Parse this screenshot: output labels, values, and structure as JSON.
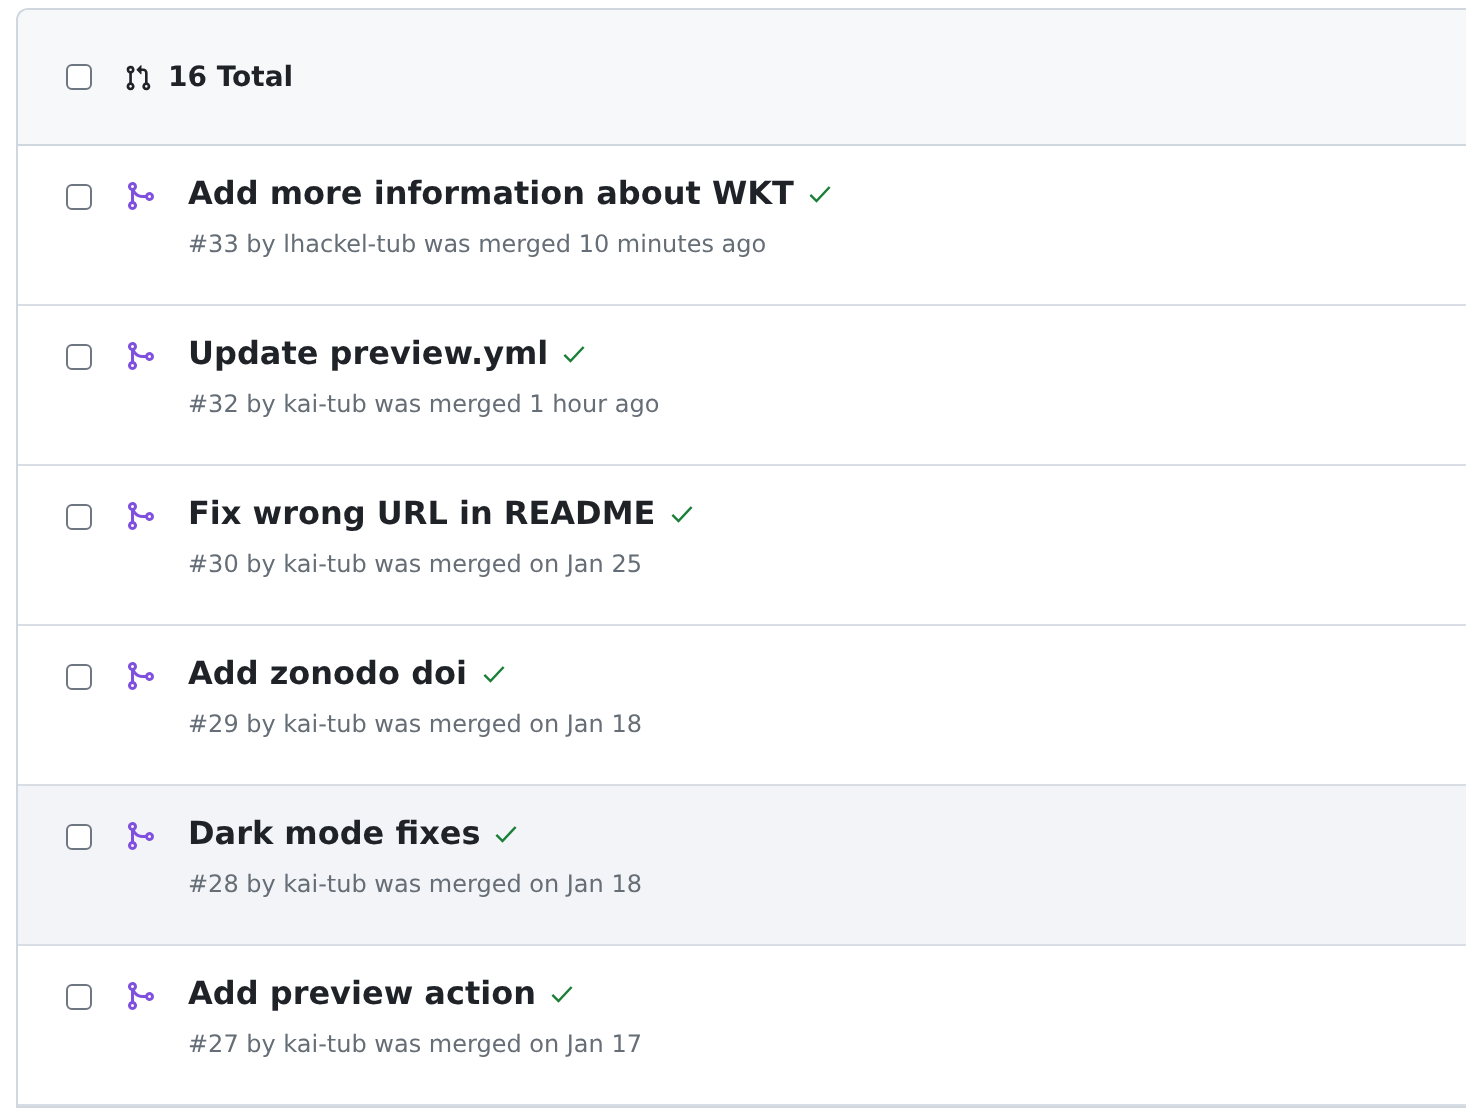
{
  "header": {
    "checked": false,
    "total": "16 Total"
  },
  "pull_requests": [
    {
      "title": "Add more information about WKT",
      "meta": "#33 by lhackel-tub was merged 10 minutes ago",
      "checked": false,
      "hovered": false
    },
    {
      "title": "Update preview.yml",
      "meta": "#32 by kai-tub was merged 1 hour ago",
      "checked": false,
      "hovered": false
    },
    {
      "title": "Fix wrong URL in README",
      "meta": "#30 by kai-tub was merged on Jan 25",
      "checked": false,
      "hovered": false
    },
    {
      "title": "Add zonodo doi",
      "meta": "#29 by kai-tub was merged on Jan 18",
      "checked": false,
      "hovered": false
    },
    {
      "title": "Dark mode fixes",
      "meta": "#28 by kai-tub was merged on Jan 18",
      "checked": false,
      "hovered": true
    },
    {
      "title": "Add preview action",
      "meta": "#27 by kai-tub was merged on Jan 17",
      "checked": false,
      "hovered": false
    }
  ]
}
